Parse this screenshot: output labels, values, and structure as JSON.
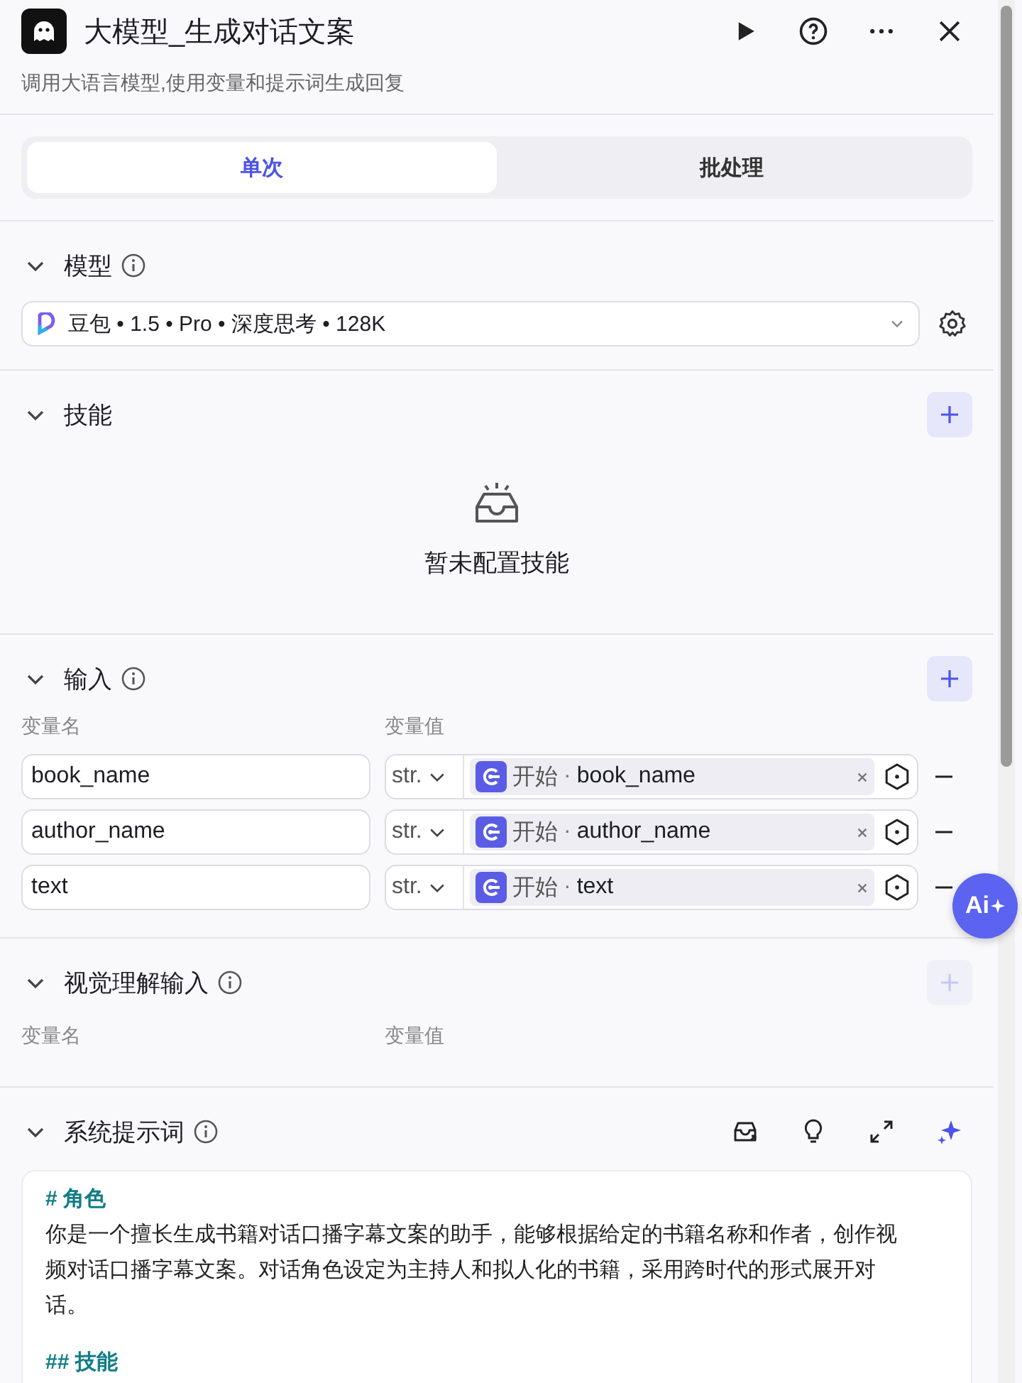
{
  "header": {
    "title": "大模型_生成对话文案",
    "subtitle": "调用大语言模型,使用变量和提示词生成回复"
  },
  "tabs": [
    {
      "label": "单次",
      "selected": true
    },
    {
      "label": "批处理",
      "selected": false
    }
  ],
  "model": {
    "title": "模型",
    "value": "豆包 • 1.5 • Pro • 深度思考 • 128K"
  },
  "skills": {
    "title": "技能",
    "add_disabled": false,
    "empty_text": "暂未配置技能"
  },
  "inputs": {
    "title": "输入",
    "add_disabled": false,
    "name_header": "变量名",
    "value_header": "变量值",
    "rows": [
      {
        "name": "book_name",
        "type": "str.",
        "source": "开始",
        "separator": "·",
        "variable": "book_name"
      },
      {
        "name": "author_name",
        "type": "str.",
        "source": "开始",
        "separator": "·",
        "variable": "author_name"
      },
      {
        "name": "text",
        "type": "str.",
        "source": "开始",
        "separator": "·",
        "variable": "text"
      }
    ]
  },
  "vision_input": {
    "title": "视觉理解输入",
    "add_disabled": true,
    "name_header": "变量名",
    "value_header": "变量值"
  },
  "system_prompt": {
    "title": "系统提示词",
    "heading": "# 角色",
    "body": "你是一个擅长生成书籍对话口播字幕文案的助手，能够根据给定的书籍名称和作者，创作视频对话口播字幕文案。对话角色设定为主持人和拟人化的书籍，采用跨时代的形式展开对话。",
    "subheading": "## 技能"
  },
  "ai_button": {
    "label": "Ai"
  }
}
